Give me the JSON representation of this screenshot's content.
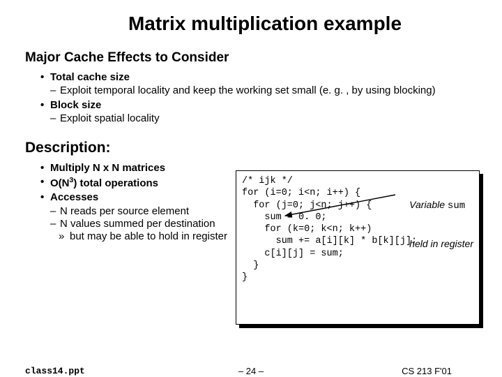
{
  "title": "Matrix multiplication example",
  "section1": {
    "heading": "Major Cache Effects to Consider",
    "b1": "Total cache size",
    "b1_sub": "Exploit temporal locality and keep the working set small (e. g. , by using blocking)",
    "b2": "Block size",
    "b2_sub": "Exploit spatial locality"
  },
  "section2": {
    "heading": "Description:",
    "d1": "Multiply N x N matrices",
    "d2_pre": "O(N",
    "d2_sup": "3",
    "d2_post": ") total operations",
    "d3": "Accesses",
    "d3_a": "N reads per source element",
    "d3_b": "N values summed per destination",
    "d3_c": "but may be able to hold in register"
  },
  "code": {
    "l1": "/* ijk */",
    "l2": "for (i=0; i<n; i++) {",
    "l3": "  for (j=0; j<n; j++) {",
    "l4": "    sum = 0. 0;",
    "l5": "    for (k=0; k<n; k++)",
    "l6": "      sum += a[i][k] * b[k][j];",
    "l7": "    c[i][j] = sum;",
    "l8": "  }",
    "l9": "}"
  },
  "annotation": {
    "line1_pre": "Variable ",
    "line1_mono": "sum",
    "line2": "held in register"
  },
  "footer": {
    "left": "class14.ppt",
    "center": "– 24 –",
    "right": "CS 213 F'01"
  }
}
